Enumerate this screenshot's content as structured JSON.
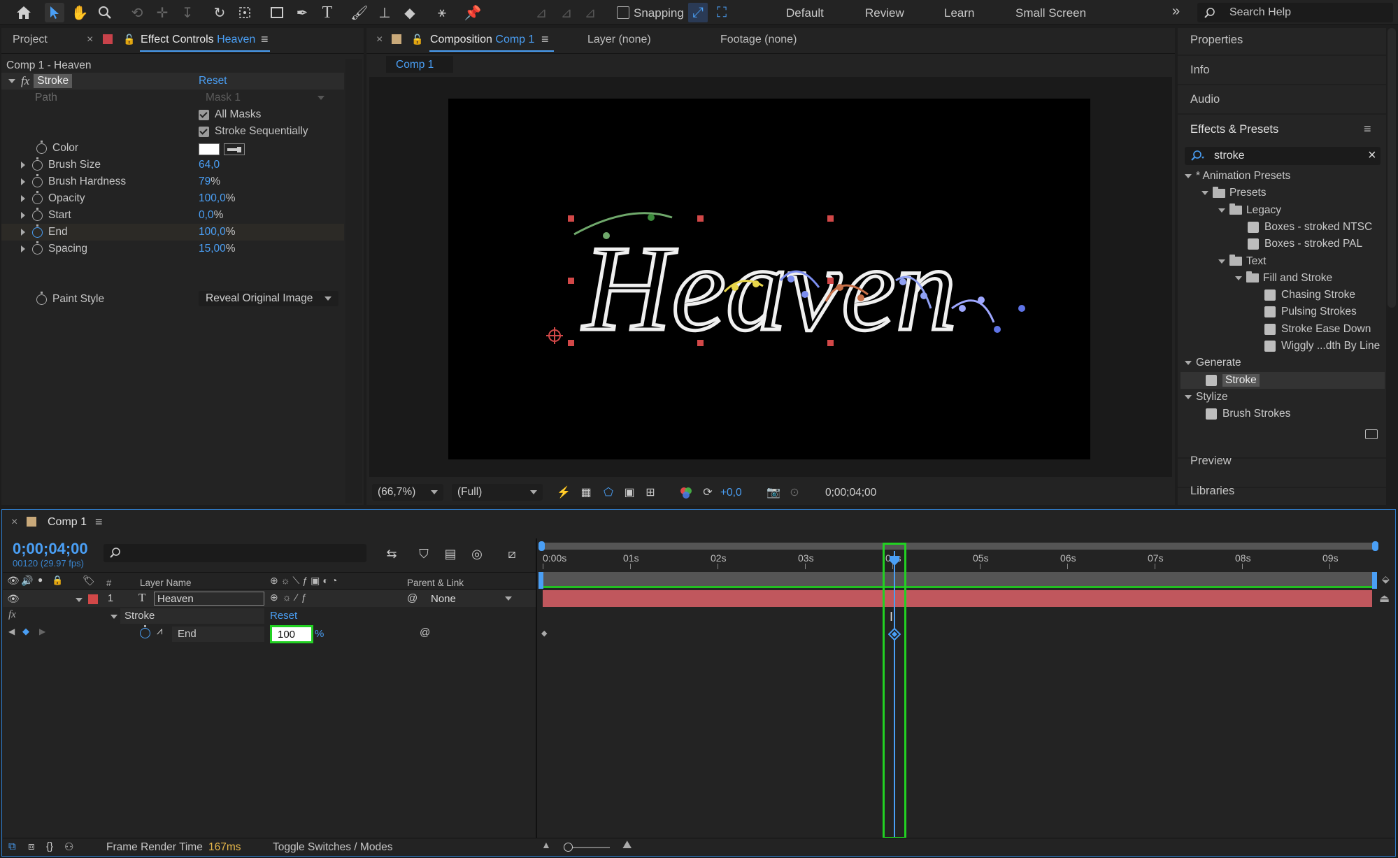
{
  "toolbar": {
    "snapping_label": "Snapping",
    "workspaces": [
      "Default",
      "Review",
      "Learn",
      "Small Screen"
    ],
    "search_placeholder": "Search Help",
    "overflow": "»"
  },
  "left_panel": {
    "tabs": {
      "project": "Project",
      "effect_controls_prefix": "Effect Controls",
      "effect_controls_layer": "Heaven"
    },
    "title": "Comp 1 - Heaven",
    "effect": {
      "fx": "fx",
      "name": "Stroke",
      "reset": "Reset"
    },
    "path": {
      "label": "Path",
      "value": "Mask 1"
    },
    "all_masks": "All Masks",
    "stroke_sequentially": "Stroke Sequentially",
    "color_label": "Color",
    "color_value": "#ffffff",
    "properties": [
      {
        "label": "Brush Size",
        "value": "64,0",
        "unit": ""
      },
      {
        "label": "Brush Hardness",
        "value": "79",
        "unit": "%"
      },
      {
        "label": "Opacity",
        "value": "100,0",
        "unit": "%"
      },
      {
        "label": "Start",
        "value": "0,0",
        "unit": "%"
      },
      {
        "label": "End",
        "value": "100,0",
        "unit": "%"
      },
      {
        "label": "Spacing",
        "value": "15,00",
        "unit": "%"
      }
    ],
    "paint_style": {
      "label": "Paint Style",
      "value": "Reveal Original Image"
    }
  },
  "composition": {
    "tab_prefix": "Composition",
    "tab_name": "Comp 1",
    "layer_tab": "Layer (none)",
    "footage_tab": "Footage (none)",
    "sub_tab": "Comp 1",
    "text": "Heaven",
    "bottom": {
      "zoom": "(66,7%)",
      "resolution": "(Full)",
      "exposure": "+0,0",
      "timecode": "0;00;04;00"
    }
  },
  "right_panel": {
    "properties": "Properties",
    "info": "Info",
    "audio": "Audio",
    "effects_presets": "Effects & Presets",
    "search_value": "stroke",
    "tree": [
      {
        "label": "* Animation Presets",
        "level": 0,
        "type": "group"
      },
      {
        "label": "Presets",
        "level": 1,
        "type": "folder"
      },
      {
        "label": "Legacy",
        "level": 2,
        "type": "folder"
      },
      {
        "label": "Boxes - stroked NTSC",
        "level": 3,
        "type": "preset"
      },
      {
        "label": "Boxes - stroked PAL",
        "level": 3,
        "type": "preset"
      },
      {
        "label": "Text",
        "level": 2,
        "type": "folder"
      },
      {
        "label": "Fill and Stroke",
        "level": 3,
        "type": "folder"
      },
      {
        "label": "Chasing Stroke",
        "level": 4,
        "type": "preset"
      },
      {
        "label": "Pulsing Strokes",
        "level": 4,
        "type": "preset"
      },
      {
        "label": "Stroke Ease Down",
        "level": 4,
        "type": "preset"
      },
      {
        "label": "Wiggly ...dth By Line",
        "level": 4,
        "type": "preset"
      },
      {
        "label": "Generate",
        "level": 0,
        "type": "group"
      },
      {
        "label": "Stroke",
        "level": 1,
        "type": "effect",
        "selected": true
      },
      {
        "label": "Stylize",
        "level": 0,
        "type": "group"
      },
      {
        "label": "Brush Strokes",
        "level": 1,
        "type": "effect"
      }
    ],
    "preview": "Preview",
    "libraries": "Libraries"
  },
  "timeline": {
    "tab": "Comp 1",
    "timecode": "0;00;04;00",
    "frame_info": "00120 (29.97 fps)",
    "col_num": "#",
    "col_layer_name": "Layer Name",
    "col_parent": "Parent & Link",
    "layer": {
      "index": "1",
      "type_glyph": "T",
      "name": "Heaven",
      "parent": "None"
    },
    "effect_row": {
      "fx": "fx",
      "name": "Stroke",
      "reset": "Reset"
    },
    "prop_row": {
      "name": "End",
      "value": "100",
      "unit": "%"
    },
    "ruler": [
      "0:00s",
      "01s",
      "02s",
      "03s",
      "04s",
      "05s",
      "06s",
      "07s",
      "08s",
      "09s"
    ],
    "bottom": {
      "frame_render_label": "Frame Render Time",
      "frame_render_value": "167ms",
      "toggle": "Toggle Switches / Modes"
    }
  },
  "colors": {
    "accent": "#4a9ff5",
    "highlight": "#22d022",
    "layer_bar": "#c0575d",
    "label_red": "#d24848"
  }
}
